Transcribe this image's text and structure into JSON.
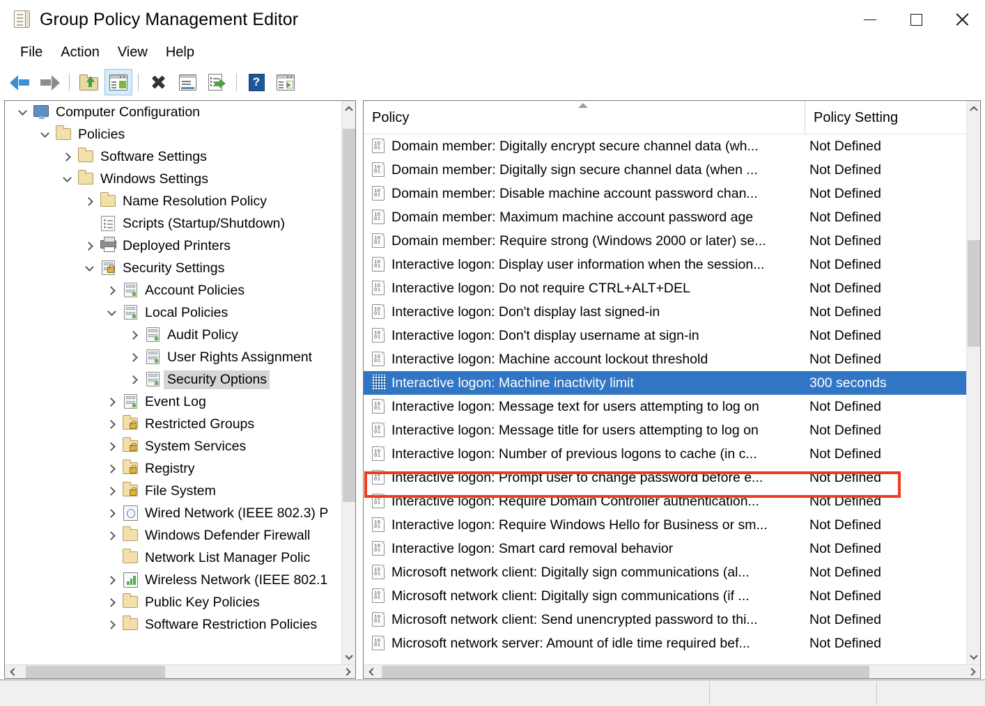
{
  "window": {
    "title": "Group Policy Management Editor",
    "icon": "policy-editor-icon",
    "controls": {
      "minimize": "minimize",
      "maximize": "maximize",
      "close": "close"
    }
  },
  "menubar": {
    "items": [
      {
        "label": "File"
      },
      {
        "label": "Action"
      },
      {
        "label": "View"
      },
      {
        "label": "Help"
      }
    ]
  },
  "toolbar": {
    "buttons": [
      {
        "name": "back-button",
        "icon": "back-arrow-icon"
      },
      {
        "name": "forward-button",
        "icon": "forward-arrow-icon"
      },
      {
        "name": "up-one-level-button",
        "icon": "up-folder-icon"
      },
      {
        "name": "show-hide-console-tree-button",
        "icon": "console-tree-icon",
        "active": true
      },
      {
        "name": "delete-button",
        "icon": "delete-x-icon"
      },
      {
        "name": "properties-button",
        "icon": "properties-icon"
      },
      {
        "name": "export-list-button",
        "icon": "export-list-icon"
      },
      {
        "name": "help-button",
        "icon": "help-question-icon"
      },
      {
        "name": "show-filter-button",
        "icon": "filter-window-icon"
      }
    ]
  },
  "tree": {
    "items": [
      {
        "label": "Computer Configuration",
        "indent": 0,
        "expander": "down",
        "icon": "computer-icon"
      },
      {
        "label": "Policies",
        "indent": 1,
        "expander": "down",
        "icon": "folder-icon"
      },
      {
        "label": "Software Settings",
        "indent": 2,
        "expander": "right",
        "icon": "folder-icon"
      },
      {
        "label": "Windows Settings",
        "indent": 2,
        "expander": "down",
        "icon": "folder-icon"
      },
      {
        "label": "Name Resolution Policy",
        "indent": 3,
        "expander": "right",
        "icon": "folder-icon"
      },
      {
        "label": "Scripts (Startup/Shutdown)",
        "indent": 3,
        "expander": "none",
        "icon": "script-icon"
      },
      {
        "label": "Deployed Printers",
        "indent": 3,
        "expander": "right",
        "icon": "printer-icon"
      },
      {
        "label": "Security Settings",
        "indent": 3,
        "expander": "down",
        "icon": "security-lock-icon"
      },
      {
        "label": "Account Policies",
        "indent": 4,
        "expander": "right",
        "icon": "server-icon"
      },
      {
        "label": "Local Policies",
        "indent": 4,
        "expander": "down",
        "icon": "server-icon"
      },
      {
        "label": "Audit Policy",
        "indent": 5,
        "expander": "right",
        "icon": "server-icon"
      },
      {
        "label": "User Rights Assignment",
        "indent": 5,
        "expander": "right",
        "icon": "server-icon"
      },
      {
        "label": "Security Options",
        "indent": 5,
        "expander": "right",
        "icon": "server-icon",
        "selected": true
      },
      {
        "label": "Event Log",
        "indent": 4,
        "expander": "right",
        "icon": "server-icon"
      },
      {
        "label": "Restricted Groups",
        "indent": 4,
        "expander": "right",
        "icon": "folder-lock-icon"
      },
      {
        "label": "System Services",
        "indent": 4,
        "expander": "right",
        "icon": "folder-lock-icon"
      },
      {
        "label": "Registry",
        "indent": 4,
        "expander": "right",
        "icon": "folder-lock-icon"
      },
      {
        "label": "File System",
        "indent": 4,
        "expander": "right",
        "icon": "folder-lock-icon"
      },
      {
        "label": "Wired Network (IEEE 802.3) P",
        "indent": 4,
        "expander": "right",
        "icon": "wired-network-icon"
      },
      {
        "label": "Windows Defender Firewall",
        "indent": 4,
        "expander": "right",
        "icon": "folder-icon"
      },
      {
        "label": "Network List Manager Polic",
        "indent": 4,
        "expander": "none",
        "icon": "folder-icon"
      },
      {
        "label": "Wireless Network (IEEE 802.1",
        "indent": 4,
        "expander": "right",
        "icon": "wireless-network-icon"
      },
      {
        "label": "Public Key Policies",
        "indent": 4,
        "expander": "right",
        "icon": "folder-icon"
      },
      {
        "label": "Software Restriction Policies",
        "indent": 4,
        "expander": "right",
        "icon": "folder-icon"
      }
    ]
  },
  "list": {
    "columns": [
      {
        "label": "Policy",
        "sort": "ascending"
      },
      {
        "label": "Policy Setting"
      }
    ],
    "rows": [
      {
        "policy": "Domain member: Digitally encrypt secure channel data (wh...",
        "setting": "Not Defined"
      },
      {
        "policy": "Domain member: Digitally sign secure channel data (when ...",
        "setting": "Not Defined"
      },
      {
        "policy": "Domain member: Disable machine account password chan...",
        "setting": "Not Defined"
      },
      {
        "policy": "Domain member: Maximum machine account password age",
        "setting": "Not Defined"
      },
      {
        "policy": "Domain member: Require strong (Windows 2000 or later) se...",
        "setting": "Not Defined"
      },
      {
        "policy": "Interactive logon: Display user information when the session...",
        "setting": "Not Defined"
      },
      {
        "policy": "Interactive logon: Do not require CTRL+ALT+DEL",
        "setting": "Not Defined"
      },
      {
        "policy": "Interactive logon: Don't display last signed-in",
        "setting": "Not Defined"
      },
      {
        "policy": "Interactive logon: Don't display username at sign-in",
        "setting": "Not Defined"
      },
      {
        "policy": "Interactive logon: Machine account lockout threshold",
        "setting": "Not Defined"
      },
      {
        "policy": "Interactive logon: Machine inactivity limit",
        "setting": "300 seconds",
        "selected": true,
        "highlighted": true
      },
      {
        "policy": "Interactive logon: Message text for users attempting to log on",
        "setting": "Not Defined"
      },
      {
        "policy": "Interactive logon: Message title for users attempting to log on",
        "setting": "Not Defined"
      },
      {
        "policy": "Interactive logon: Number of previous logons to cache (in c...",
        "setting": "Not Defined"
      },
      {
        "policy": "Interactive logon: Prompt user to change password before e...",
        "setting": "Not Defined"
      },
      {
        "policy": "Interactive logon: Require Domain Controller authentication...",
        "setting": "Not Defined"
      },
      {
        "policy": "Interactive logon: Require Windows Hello for Business or sm...",
        "setting": "Not Defined"
      },
      {
        "policy": "Interactive logon: Smart card removal behavior",
        "setting": "Not Defined"
      },
      {
        "policy": "Microsoft network client: Digitally sign communications (al...",
        "setting": "Not Defined"
      },
      {
        "policy": "Microsoft network client: Digitally sign communications (if ...",
        "setting": "Not Defined"
      },
      {
        "policy": "Microsoft network client: Send unencrypted password to thi...",
        "setting": "Not Defined"
      },
      {
        "policy": "Microsoft network server: Amount of idle time required bef...",
        "setting": "Not Defined"
      }
    ]
  },
  "annotation": {
    "type": "red-highlight-box",
    "target": "Interactive logon: Machine inactivity limit"
  },
  "colors": {
    "selection_blue": "#3076c5",
    "annotation_red": "#ef3b1d",
    "tree_selection_gray": "#d6d6d6",
    "toolbar_active": "#d7ecfb"
  }
}
